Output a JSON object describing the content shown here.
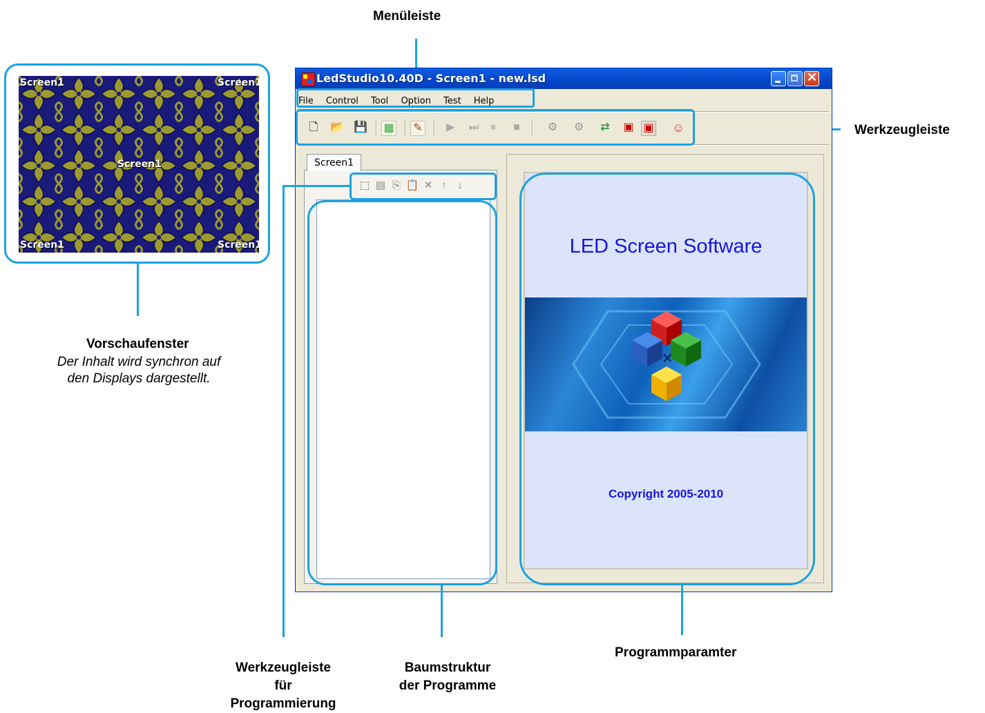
{
  "callouts": {
    "menu": "Menüleiste",
    "toolbar": "Werkzeugleiste",
    "preview_title": "Vorschaufenster",
    "preview_desc_line1": "Der Inhalt wird synchron auf",
    "preview_desc_line2": "den Displays dargestellt.",
    "prog_toolbar_line1": "Werkzeugleiste",
    "prog_toolbar_line2": "für",
    "prog_toolbar_line3": "Programmierung",
    "tree_line1": "Baumstruktur",
    "tree_line2": "der Programme",
    "params": "Programmparamter"
  },
  "preview": {
    "labels": [
      "Screen1",
      "Screen1",
      "Screen1",
      "Screen1",
      "Screen1"
    ]
  },
  "window": {
    "title": "LedStudio10.40D - Screen1 - new.lsd",
    "menu": [
      "File",
      "Control",
      "Tool",
      "Option",
      "Test",
      "Help"
    ],
    "tab": "Screen1",
    "splash_title": "LED Screen Software",
    "copyright": "Copyright 2005-2010"
  },
  "colors": {
    "accent": "#1ba1e2",
    "titlebar": "#0a4cd0",
    "splash_text": "#1515e0",
    "preview_bg": "#1a1a7a",
    "preview_pattern": "#9c9a2e"
  }
}
